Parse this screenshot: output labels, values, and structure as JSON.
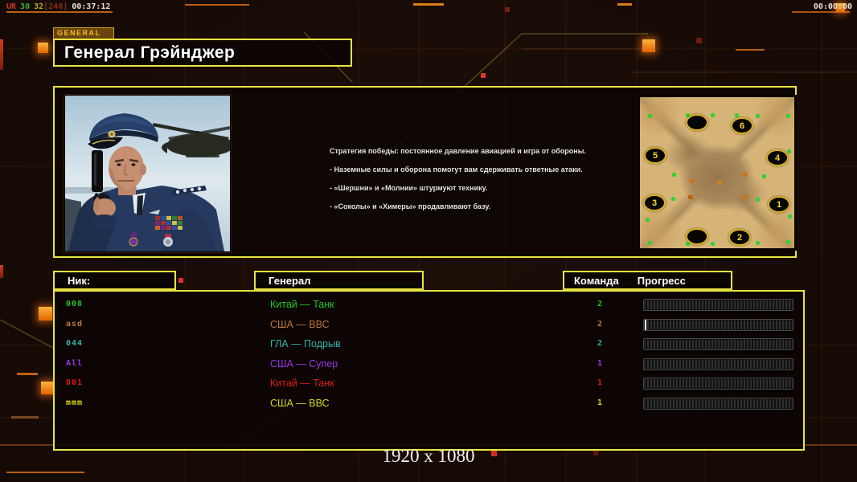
{
  "status_bar": {
    "segments": [
      {
        "text": "UR",
        "color": "#c9392a"
      },
      {
        "text": "30",
        "color": "#3fae3f"
      },
      {
        "text": "32",
        "color": "#a9b326"
      },
      {
        "text": "[240]",
        "color": "#8a2a16"
      },
      {
        "text": "00:37:12",
        "color": "#e6dfd6"
      }
    ],
    "clock": "00:00:00"
  },
  "header": {
    "tag": "GENERAL",
    "title": "Генерал Грэйнджер"
  },
  "briefing": {
    "lines": [
      "Стратегия победы: постоянное давление авиацией и игра от обороны.",
      "- Наземные силы и оборона помогут вам сдерживать ответные атаки.",
      "- «Шершни» и «Молнии» штурмуют технику.",
      "- «Соколы» и «Химеры» продавливают базу."
    ]
  },
  "map_preview": {
    "spawn_labels": [
      "",
      "6",
      "5",
      "4",
      "3",
      "1",
      "",
      "2"
    ]
  },
  "roster": {
    "headers": {
      "nick": "Ник:",
      "general": "Генерал",
      "team": "Команда",
      "progress": "Прогресс"
    },
    "players": [
      {
        "nick": "008",
        "general": "Китай — Танк",
        "team": "2",
        "color": "#1ec81e"
      },
      {
        "nick": "asd",
        "general": "США — ВВС",
        "team": "2",
        "color": "#c0763b"
      },
      {
        "nick": "044",
        "general": "ГЛА — Подрыв",
        "team": "2",
        "color": "#2db3ac"
      },
      {
        "nick": "All",
        "general": "США — Супер",
        "team": "1",
        "color": "#9b35ea"
      },
      {
        "nick": "001",
        "general": "Китай — Танк",
        "team": "1",
        "color": "#e01911"
      },
      {
        "nick": "mmm",
        "general": "США — ВВС",
        "team": "1",
        "color": "#d6d61c"
      }
    ]
  },
  "footer": {
    "resolution": "1920 x 1080"
  }
}
